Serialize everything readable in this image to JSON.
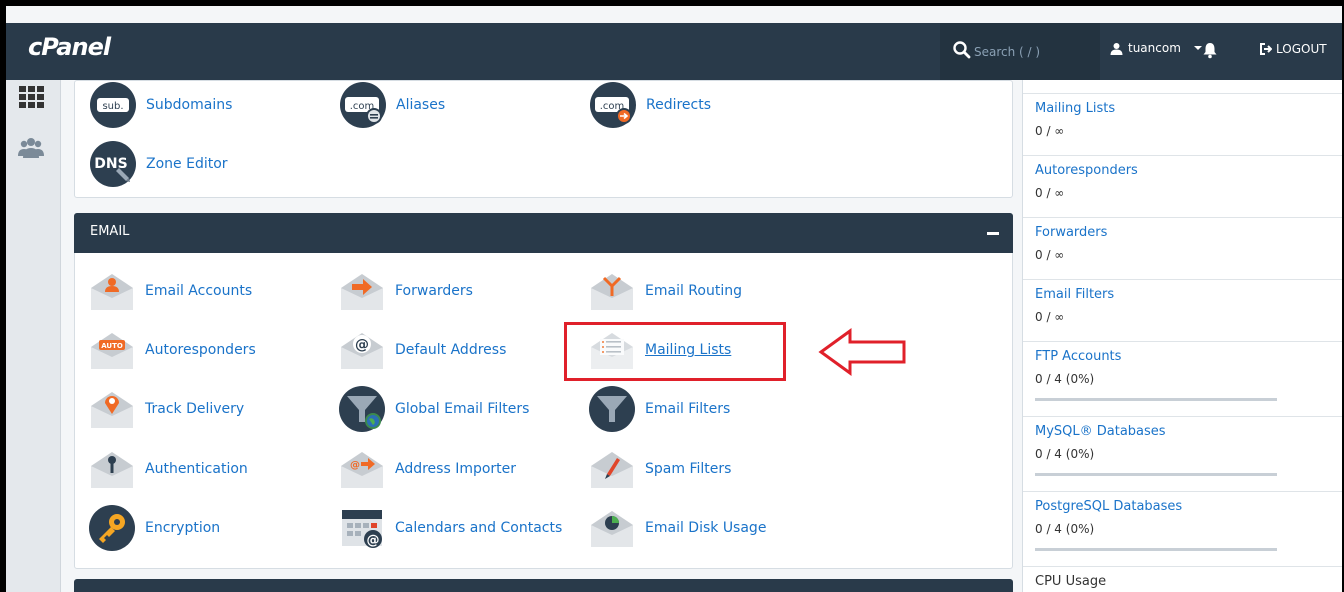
{
  "header": {
    "logo": "cPanel",
    "search_placeholder": "Search ( / )",
    "user": "tuancom",
    "logout": "LOGOUT"
  },
  "domains_section": {
    "items": [
      {
        "label": "Subdomains",
        "icon": "subdomains-icon"
      },
      {
        "label": "Aliases",
        "icon": "aliases-icon"
      },
      {
        "label": "Redirects",
        "icon": "redirects-icon"
      },
      {
        "label": "Zone Editor",
        "icon": "zone-editor-icon"
      }
    ]
  },
  "email_section": {
    "title": "EMAIL",
    "items": [
      {
        "label": "Email Accounts"
      },
      {
        "label": "Forwarders"
      },
      {
        "label": "Email Routing"
      },
      {
        "label": "Autoresponders"
      },
      {
        "label": "Default Address"
      },
      {
        "label": "Mailing Lists"
      },
      {
        "label": "Track Delivery"
      },
      {
        "label": "Global Email Filters"
      },
      {
        "label": "Email Filters"
      },
      {
        "label": "Authentication"
      },
      {
        "label": "Address Importer"
      },
      {
        "label": "Spam Filters"
      },
      {
        "label": "Encryption"
      },
      {
        "label": "Calendars and Contacts"
      },
      {
        "label": "Email Disk Usage"
      }
    ]
  },
  "stats": {
    "items": [
      {
        "label": "Mailing Lists",
        "value": "0 / ∞"
      },
      {
        "label": "Autoresponders",
        "value": "0 / ∞"
      },
      {
        "label": "Forwarders",
        "value": "0 / ∞"
      },
      {
        "label": "Email Filters",
        "value": "0 / ∞"
      },
      {
        "label": "FTP Accounts",
        "value": "0 / 4  (0%)",
        "usage": 0
      },
      {
        "label": "MySQL® Databases",
        "value": "0 / 4  (0%)",
        "usage": 0
      },
      {
        "label": "PostgreSQL Databases",
        "value": "0 / 4  (0%)",
        "usage": 0
      },
      {
        "label": "CPU Usage"
      }
    ]
  },
  "colors": {
    "header": "#293a4a",
    "link": "#1a73c9",
    "highlight": "#e0202a"
  }
}
